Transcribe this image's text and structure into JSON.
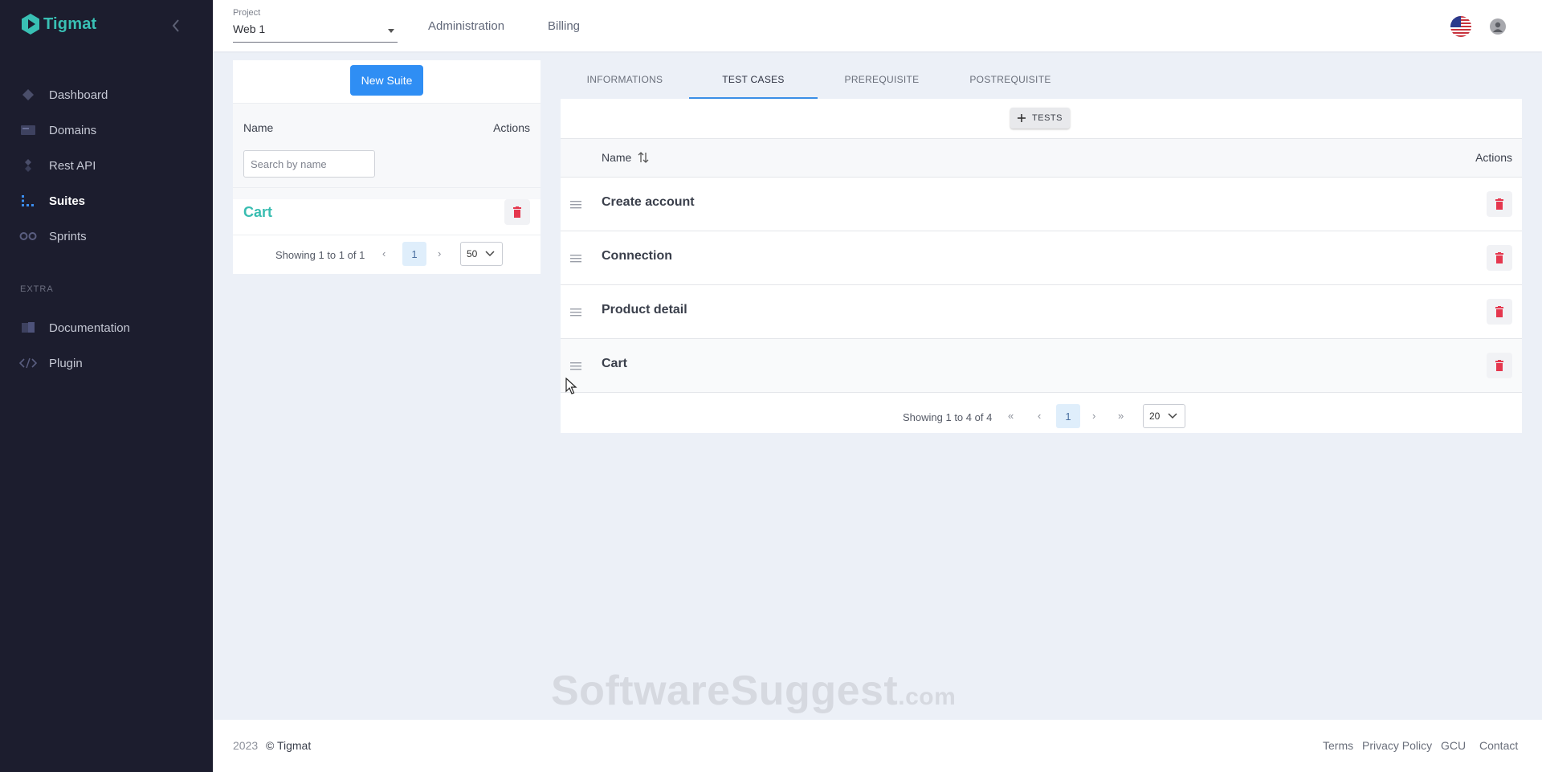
{
  "app": {
    "name": "Tigmat",
    "brand_color": "#39c0b4",
    "sidebar_bg": "#1c1d2e"
  },
  "sidebar": {
    "items": [
      {
        "label": "Dashboard",
        "icon": "dashboard-icon"
      },
      {
        "label": "Domains",
        "icon": "domains-icon"
      },
      {
        "label": "Rest API",
        "icon": "rest-api-icon"
      },
      {
        "label": "Suites",
        "icon": "suites-icon",
        "active": true
      },
      {
        "label": "Sprints",
        "icon": "sprints-icon"
      }
    ],
    "section_extra": "EXTRA",
    "extra_items": [
      {
        "label": "Documentation",
        "icon": "book-icon"
      },
      {
        "label": "Plugin",
        "icon": "code-icon"
      }
    ]
  },
  "header": {
    "project_label": "Project",
    "project_value": "Web 1",
    "links": [
      "Administration",
      "Billing"
    ]
  },
  "suites_panel": {
    "new_suite_label": "New Suite",
    "col_name": "Name",
    "col_actions": "Actions",
    "search_placeholder": "Search by name",
    "rows": [
      "Cart"
    ],
    "pager": {
      "text": "Showing 1 to 1 of 1",
      "page": "1",
      "page_size": "50"
    }
  },
  "tabs": {
    "items": [
      "INFORMATIONS",
      "TEST CASES",
      "PREREQUISITE",
      "POSTREQUISITE"
    ],
    "active": "TEST CASES"
  },
  "test_cases": {
    "add_tests_label": "TESTS",
    "col_name": "Name",
    "col_actions": "Actions",
    "rows": [
      "Create account",
      "Connection",
      "Product detail",
      "Cart"
    ],
    "pager": {
      "text": "Showing 1 to 4 of 4",
      "page": "1",
      "page_size": "20"
    }
  },
  "watermark": {
    "text": "SoftwareSuggest",
    "suffix": ".com"
  },
  "footer": {
    "year": "2023",
    "copyright": "© Tigmat",
    "links": [
      "Terms",
      "Privacy Policy",
      "GCU",
      "Contact"
    ]
  },
  "colors": {
    "primary_button": "#2f8ef4",
    "delete_icon": "#e5374e",
    "tab_underline": "#3a8ee6"
  }
}
